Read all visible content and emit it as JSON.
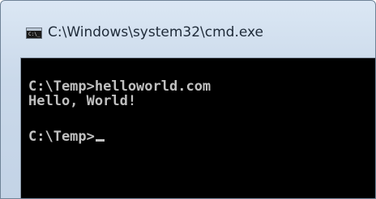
{
  "window": {
    "title": "C:\\Windows\\system32\\cmd.exe",
    "icon": "cmd-console-icon"
  },
  "console": {
    "lines": [
      "C:\\Temp>helloworld.com",
      "Hello, World!",
      "",
      "C:\\Temp>"
    ]
  }
}
